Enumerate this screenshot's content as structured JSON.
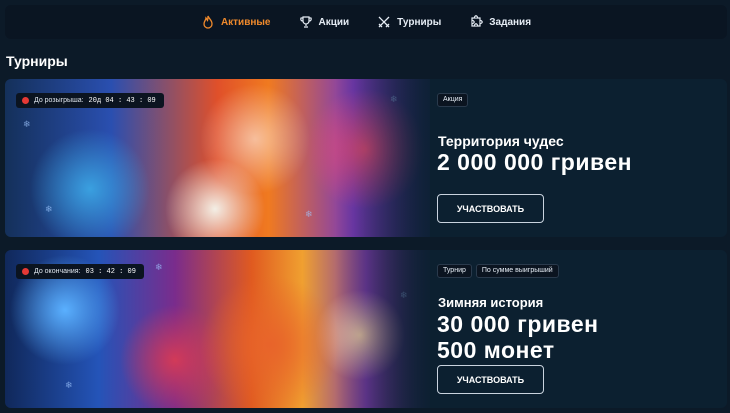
{
  "tabs": [
    {
      "label": "Активные",
      "icon": "flame-icon",
      "active": true
    },
    {
      "label": "Акции",
      "icon": "trophy-icon",
      "active": false
    },
    {
      "label": "Турниры",
      "icon": "crossed-swords-icon",
      "active": false
    },
    {
      "label": "Задания",
      "icon": "puzzle-icon",
      "active": false
    }
  ],
  "section_title": "Турниры",
  "colors": {
    "accent": "#f08a2c",
    "background": "#0c1a28",
    "card": "#0c2030",
    "timer_dot": "#e53935"
  },
  "cards": [
    {
      "timer_label": "До розыгрыша:",
      "timer_value": "20д 04 : 43 : 09",
      "badges": [
        "Акция"
      ],
      "title": "Территория чудес",
      "prizes": [
        "2 000 000 гривен"
      ],
      "button": "УЧАСТВОВАТЬ"
    },
    {
      "timer_label": "До окончания:",
      "timer_value": "03 : 42 : 09",
      "badges": [
        "Турнир",
        "По сумме выигрыший"
      ],
      "title": "Зимняя история",
      "prizes": [
        "30 000 гривен",
        "500 монет"
      ],
      "button": "УЧАСТВОВАТЬ"
    }
  ]
}
